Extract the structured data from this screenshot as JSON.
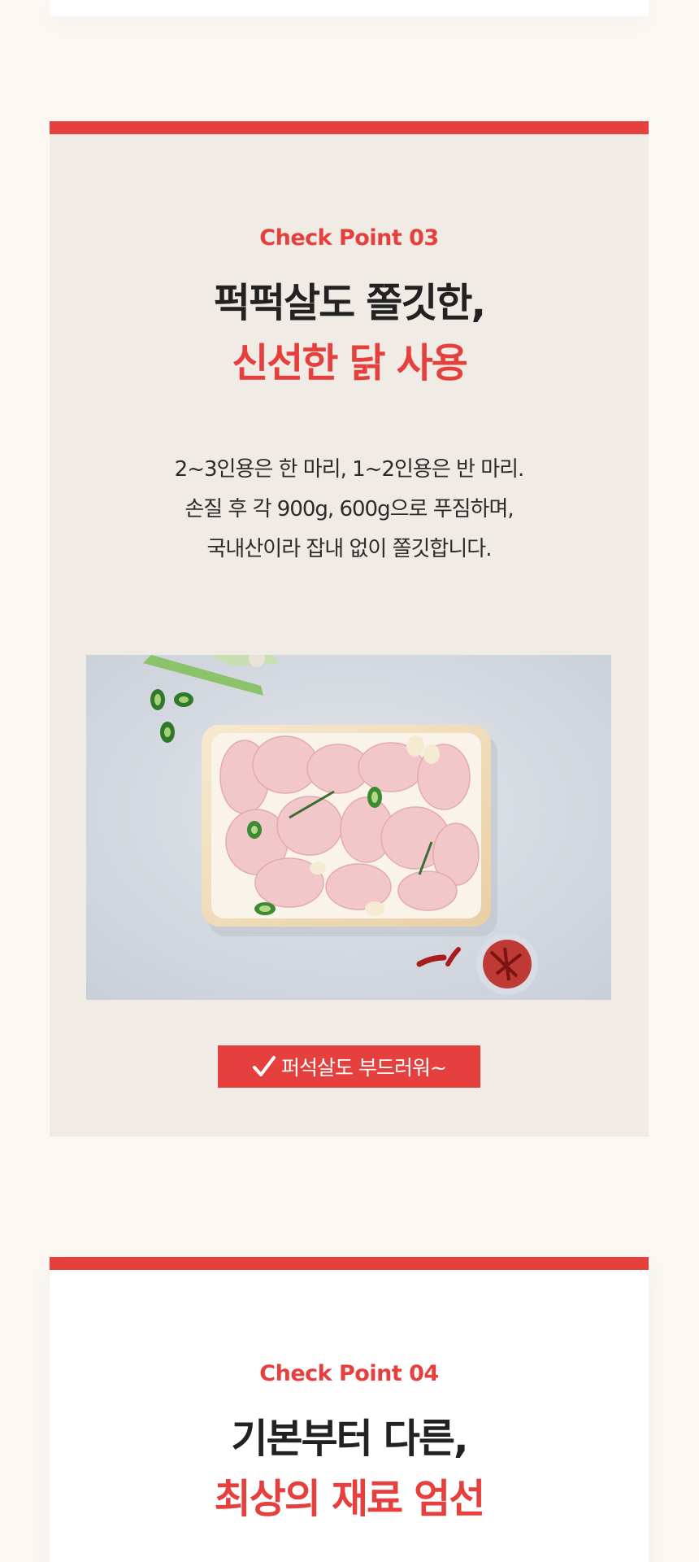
{
  "section_03": {
    "check_label": "Check Point 03",
    "headline_line1": "퍽퍽살도 쫄깃한,",
    "headline_line2": "신선한 닭 사용",
    "description": [
      "2~3인용은 한 마리, 1~2인용은 반 마리.",
      "손질 후 각 900g, 600g으로 푸짐하며,",
      "국내산이라 잡내 없이 쫄깃합니다."
    ],
    "badge_text": "퍼석살도 부드러워~",
    "badge_icon": "check-icon"
  },
  "section_04": {
    "check_label": "Check Point 04",
    "headline_line1": "기본부터 다른,",
    "headline_line2": "최상의 재료 엄선"
  },
  "colors": {
    "accent_red": "#e5403e",
    "card_beige": "#f0ebe4",
    "page_bg": "#fbf8f4",
    "text_dark": "#222222"
  }
}
